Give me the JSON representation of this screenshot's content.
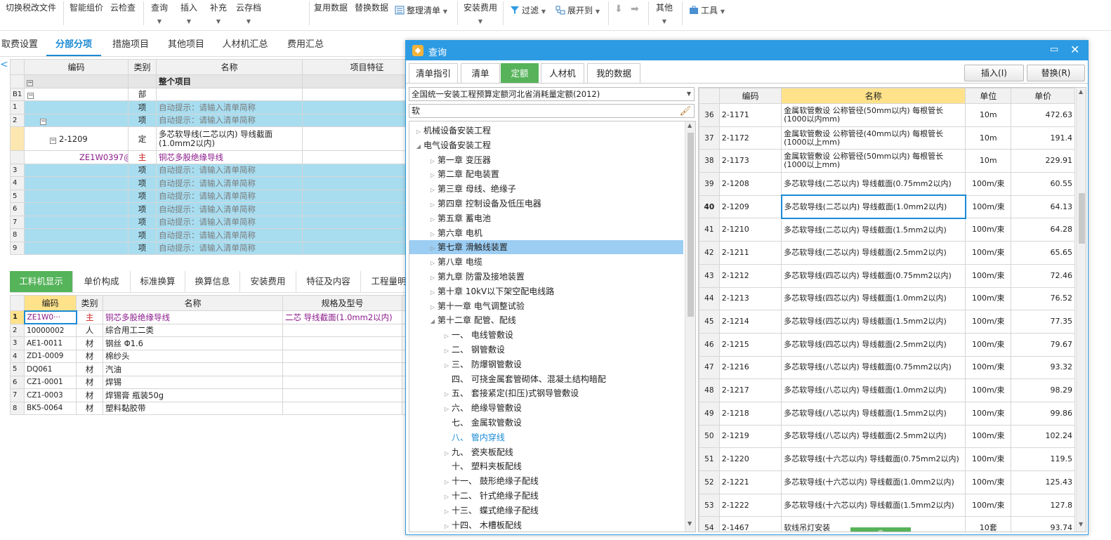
{
  "toolbar": {
    "switch_tax": "切换税改文件",
    "smart_price": "智能组价",
    "cloud_check": "云检查",
    "query": "查询",
    "insert": "插入",
    "supplement": "补充",
    "cloud_save": "云存档",
    "reuse_data": "复用数据",
    "replace_data": "替换数据",
    "organize_list": "整理清单",
    "install_cost": "安装费用",
    "filter": "过滤",
    "expand_to": "展开到",
    "other": "其他",
    "tools": "工具"
  },
  "main_tabs": [
    "取费设置",
    "分部分项",
    "措施项目",
    "其他项目",
    "人材机汇总",
    "费用汇总"
  ],
  "upper_grid": {
    "headers": [
      "编码",
      "类别",
      "名称",
      "项目特征"
    ],
    "whole_project": "整个项目",
    "rows": [
      {
        "rn": "B1",
        "code": "",
        "type": "部",
        "name": "",
        "hint": false,
        "hl": false
      },
      {
        "rn": "1",
        "code": "",
        "type": "项",
        "name": "自动提示：请输入清单简称",
        "hint": true,
        "hl": true
      },
      {
        "rn": "2",
        "code": "",
        "type": "项",
        "name": "自动提示：请输入清单简称",
        "hint": true,
        "hl": true
      },
      {
        "rn": "",
        "code": "2-1209",
        "type": "定",
        "name": "多芯软导线(二芯以内) 导线截面(1.0mm2以内)",
        "hint": false,
        "hl": false
      },
      {
        "rn": "",
        "code": "ZE1W0397@1",
        "type": "主",
        "name": "铜芯多股绝缘导线",
        "hint": false,
        "hl": false
      },
      {
        "rn": "3",
        "code": "",
        "type": "项",
        "name": "自动提示：请输入清单简称",
        "hint": true,
        "hl": true
      },
      {
        "rn": "4",
        "code": "",
        "type": "项",
        "name": "自动提示：请输入清单简称",
        "hint": true,
        "hl": true
      },
      {
        "rn": "5",
        "code": "",
        "type": "项",
        "name": "自动提示：请输入清单简称",
        "hint": true,
        "hl": true
      },
      {
        "rn": "6",
        "code": "",
        "type": "项",
        "name": "自动提示：请输入清单简称",
        "hint": true,
        "hl": true
      },
      {
        "rn": "7",
        "code": "",
        "type": "项",
        "name": "自动提示：请输入清单简称",
        "hint": true,
        "hl": true
      },
      {
        "rn": "8",
        "code": "",
        "type": "项",
        "name": "自动提示：请输入清单简称",
        "hint": true,
        "hl": true
      },
      {
        "rn": "9",
        "code": "",
        "type": "项",
        "name": "自动提示：请输入清单简称",
        "hint": true,
        "hl": true
      }
    ]
  },
  "bottom_tabs": [
    "工料机显示",
    "单价构成",
    "标准换算",
    "换算信息",
    "安装费用",
    "特征及内容",
    "工程量明"
  ],
  "lower_grid": {
    "headers": [
      "编码",
      "类别",
      "名称",
      "规格及型号",
      "单"
    ],
    "rows": [
      {
        "rn": "1",
        "code": "ZE1W0···",
        "type": "主",
        "name": "铜芯多股绝缘导线",
        "spec": "二芯 导线截面(1.0mm2以内)"
      },
      {
        "rn": "2",
        "code": "10000002",
        "type": "人",
        "name": "综合用工二类",
        "spec": ""
      },
      {
        "rn": "3",
        "code": "AE1-0011",
        "type": "材",
        "name": "钢丝 Φ1.6",
        "spec": ""
      },
      {
        "rn": "4",
        "code": "ZD1-0009",
        "type": "材",
        "name": "棉纱头",
        "spec": ""
      },
      {
        "rn": "5",
        "code": "DQ061",
        "type": "材",
        "name": "汽油",
        "spec": ""
      },
      {
        "rn": "6",
        "code": "CZ1-0001",
        "type": "材",
        "name": "焊锡",
        "spec": ""
      },
      {
        "rn": "7",
        "code": "CZ1-0003",
        "type": "材",
        "name": "焊锡膏 瓶装50g",
        "spec": ""
      },
      {
        "rn": "8",
        "code": "BK5-0064",
        "type": "材",
        "name": "塑料黏胶带",
        "spec": ""
      }
    ]
  },
  "dialog": {
    "title": "查询",
    "tabs": [
      "清单指引",
      "清单",
      "定额",
      "人材机",
      "我的数据"
    ],
    "insert_btn": "插入(I)",
    "replace_btn": "替换(R)",
    "quota_select": "全国统一安装工程预算定额河北省消耗量定额(2012)",
    "search_value": "软",
    "tree": [
      {
        "label": "机械设备安装工程",
        "lvl": 0,
        "arrow": "right"
      },
      {
        "label": "电气设备安装工程",
        "lvl": 0,
        "arrow": "down"
      },
      {
        "label": "第一章 变压器",
        "lvl": 1,
        "arrow": "right"
      },
      {
        "label": "第二章 配电装置",
        "lvl": 1,
        "arrow": "right"
      },
      {
        "label": "第三章 母线、绝缘子",
        "lvl": 1,
        "arrow": "right"
      },
      {
        "label": "第四章 控制设备及低压电器",
        "lvl": 1,
        "arrow": "right"
      },
      {
        "label": "第五章 蓄电池",
        "lvl": 1,
        "arrow": "right"
      },
      {
        "label": "第六章 电机",
        "lvl": 1,
        "arrow": "right"
      },
      {
        "label": "第七章 滑触线装置",
        "lvl": 1,
        "arrow": "right",
        "selected": true
      },
      {
        "label": "第八章 电缆",
        "lvl": 1,
        "arrow": "right"
      },
      {
        "label": "第九章 防雷及接地装置",
        "lvl": 1,
        "arrow": "right"
      },
      {
        "label": "第十章 10kV以下架空配电线路",
        "lvl": 1,
        "arrow": "right"
      },
      {
        "label": "第十一章 电气调整试验",
        "lvl": 1,
        "arrow": "right"
      },
      {
        "label": "第十二章 配管、配线",
        "lvl": 1,
        "arrow": "down"
      },
      {
        "label": "一、 电线管敷设",
        "lvl": 2,
        "arrow": "right"
      },
      {
        "label": "二、 钢管敷设",
        "lvl": 2,
        "arrow": "right"
      },
      {
        "label": "三、 防爆钢管敷设",
        "lvl": 2,
        "arrow": "right"
      },
      {
        "label": "四、 可挠金属套管砌体、混凝土结构暗配",
        "lvl": 2,
        "arrow": ""
      },
      {
        "label": "五、 套接紧定(扣压)式钢导管敷设",
        "lvl": 2,
        "arrow": "right"
      },
      {
        "label": "六、 绝缘导管敷设",
        "lvl": 2,
        "arrow": "right"
      },
      {
        "label": "七、 金属软管敷设",
        "lvl": 2,
        "arrow": ""
      },
      {
        "label": "八、 管内穿线",
        "lvl": 2,
        "arrow": "",
        "active": true
      },
      {
        "label": "九、 瓷夹板配线",
        "lvl": 2,
        "arrow": "right"
      },
      {
        "label": "十、 塑料夹板配线",
        "lvl": 2,
        "arrow": ""
      },
      {
        "label": "十一、 鼓形绝缘子配线",
        "lvl": 2,
        "arrow": "right"
      },
      {
        "label": "十二、 针式绝缘子配线",
        "lvl": 2,
        "arrow": "right"
      },
      {
        "label": "十三、 蝶式绝缘子配线",
        "lvl": 2,
        "arrow": "right"
      },
      {
        "label": "十四、 木槽板配线",
        "lvl": 2,
        "arrow": "right"
      }
    ],
    "grid_headers": [
      "编码",
      "名称",
      "单位",
      "单价"
    ],
    "grid_rows": [
      {
        "n": "36",
        "code": "2-1171",
        "name": "金属软管敷设 公称管径(50mm以内) 每根管长(1000以内mm)",
        "unit": "10m",
        "price": "472.63"
      },
      {
        "n": "37",
        "code": "2-1172",
        "name": "金属软管敷设 公称管径(40mm以内) 每根管长(1000以上mm)",
        "unit": "10m",
        "price": "191.4"
      },
      {
        "n": "38",
        "code": "2-1173",
        "name": "金属软管敷设 公称管径(50mm以内) 每根管长(1000以上mm)",
        "unit": "10m",
        "price": "229.91"
      },
      {
        "n": "39",
        "code": "2-1208",
        "name": "多芯软导线(二芯以内) 导线截面(0.75mm2以内)",
        "unit": "100m/束",
        "price": "60.55"
      },
      {
        "n": "40",
        "code": "2-1209",
        "name": "多芯软导线(二芯以内) 导线截面(1.0mm2以内)",
        "unit": "100m/束",
        "price": "64.13",
        "sel": true
      },
      {
        "n": "41",
        "code": "2-1210",
        "name": "多芯软导线(二芯以内) 导线截面(1.5mm2以内)",
        "unit": "100m/束",
        "price": "64.28"
      },
      {
        "n": "42",
        "code": "2-1211",
        "name": "多芯软导线(二芯以内) 导线截面(2.5mm2以内)",
        "unit": "100m/束",
        "price": "65.65"
      },
      {
        "n": "43",
        "code": "2-1212",
        "name": "多芯软导线(四芯以内) 导线截面(0.75mm2以内)",
        "unit": "100m/束",
        "price": "72.46"
      },
      {
        "n": "44",
        "code": "2-1213",
        "name": "多芯软导线(四芯以内) 导线截面(1.0mm2以内)",
        "unit": "100m/束",
        "price": "76.52"
      },
      {
        "n": "45",
        "code": "2-1214",
        "name": "多芯软导线(四芯以内) 导线截面(1.5mm2以内)",
        "unit": "100m/束",
        "price": "77.35"
      },
      {
        "n": "46",
        "code": "2-1215",
        "name": "多芯软导线(四芯以内) 导线截面(2.5mm2以内)",
        "unit": "100m/束",
        "price": "79.67"
      },
      {
        "n": "47",
        "code": "2-1216",
        "name": "多芯软导线(八芯以内) 导线截面(0.75mm2以内)",
        "unit": "100m/束",
        "price": "93.32"
      },
      {
        "n": "48",
        "code": "2-1217",
        "name": "多芯软导线(八芯以内) 导线截面(1.0mm2以内)",
        "unit": "100m/束",
        "price": "98.29"
      },
      {
        "n": "49",
        "code": "2-1218",
        "name": "多芯软导线(八芯以内) 导线截面(1.5mm2以内)",
        "unit": "100m/束",
        "price": "99.86"
      },
      {
        "n": "50",
        "code": "2-1219",
        "name": "多芯软导线(八芯以内) 导线截面(2.5mm2以内)",
        "unit": "100m/束",
        "price": "102.24"
      },
      {
        "n": "51",
        "code": "2-1220",
        "name": "多芯软导线(十六芯以内) 导线截面(0.75mm2以内)",
        "unit": "100m/束",
        "price": "119.5"
      },
      {
        "n": "52",
        "code": "2-1221",
        "name": "多芯软导线(十六芯以内) 导线截面(1.0mm2以内)",
        "unit": "100m/束",
        "price": "125.43"
      },
      {
        "n": "53",
        "code": "2-1222",
        "name": "多芯软导线(十六芯以内) 导线截面(1.5mm2以内)",
        "unit": "100m/束",
        "price": "127.8"
      },
      {
        "n": "54",
        "code": "2-1467",
        "name": "软线吊灯安装",
        "unit": "10套",
        "price": "93.74"
      }
    ]
  }
}
